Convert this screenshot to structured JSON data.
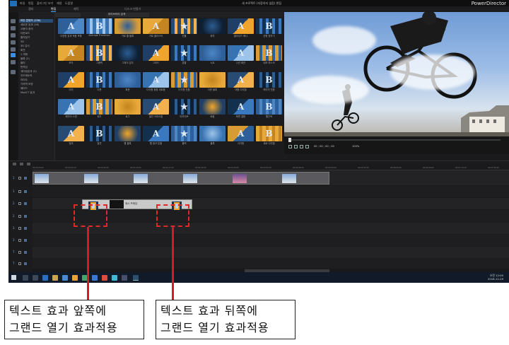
{
  "app": {
    "brand": "PowerDirector",
    "project_title": "새 프로젝트 (저장하지 않음) 편집",
    "menu": [
      "파일",
      "편집",
      "플러그인",
      "보기",
      "재생",
      "도움말"
    ],
    "modes": [
      "캡처",
      "편집",
      "제작",
      "디스크 만들기"
    ],
    "active_mode": "편집"
  },
  "library": {
    "dropdown": "모든 콘텐츠",
    "search_placeholder": "라이브러리 검색",
    "tree": [
      "모든 콘텐츠 (156)",
      "새로운 효과 (18)",
      "사용자 정의",
      "다운로드",
      "즐겨찾기",
      "3D",
      "3D 유사",
      "회전",
      "1 개체",
      "블록 (2)",
      "블러",
      "번쩍임",
      "세어링효과 (5)",
      "지오메트릭",
      "라이트",
      "기하학 모양",
      "페이드",
      "ModCT 효과"
    ],
    "effects": [
      "다양한 효과 적용 포함",
      "Average Transition",
      "가로 줄 블록",
      "가로 클러스터",
      "건물",
      "위치",
      "클라우드 애니",
      "균형 맞추기",
      "조각",
      "그래픽",
      "그레이 입자",
      "그리드",
      "분할",
      "시트",
      "나선 회전",
      "네모 마스크",
      "다리",
      "다층",
      "파문",
      "다각형 환원 새로움",
      "다각형 전환",
      "다운 블록",
      "대형 디지털",
      "레이어 전환",
      "레이어 스캔",
      "로드",
      "로그",
      "발진 크리스탈",
      "아카이브",
      "바람",
      "화면 결합",
      "빨간색",
      "빛의",
      "발견",
      "웹 블록",
      "웹 링크 분할",
      "블럭",
      "블록",
      "사각형",
      "세로 디지털"
    ]
  },
  "preview": {
    "timecode": "00 ; 00 ; 00 ; 00",
    "zoom": "100%"
  },
  "timeline": {
    "ruler": [
      "00;00;00;00",
      "00;00;33;10",
      "00;01;06;20",
      "00;01;40;00",
      "00;02;13;10",
      "00;02;46;20",
      "00;03;20;00",
      "00;03;53;10",
      "00;04;26;20",
      "00;05;00;00",
      "00;05;33;10",
      "00;06;06;20",
      "00;06;40;00",
      "00;07;13;10",
      "00;07;46;20"
    ],
    "track_labels": [
      "1",
      "1",
      "2",
      "2",
      "3",
      "3",
      "T",
      "T"
    ],
    "text_clip_label": "자막을 재생",
    "text_clip_label2": "제시 프레임"
  },
  "taskbar": {
    "time": "오전 12:00",
    "date": "2016-12-29"
  },
  "callouts": {
    "left": [
      "텍스트 효과 앞쪽에",
      "그랜드 열기 효과적용"
    ],
    "right": [
      "텍스트 효과 뒤쪽에",
      "그랜드 열기 효과적용"
    ]
  },
  "colors": {
    "accent": "#3a8fe0",
    "annotation": "#e0282a",
    "tile_gold": "#f0a52a",
    "tile_blue": "#2d5f9a"
  }
}
